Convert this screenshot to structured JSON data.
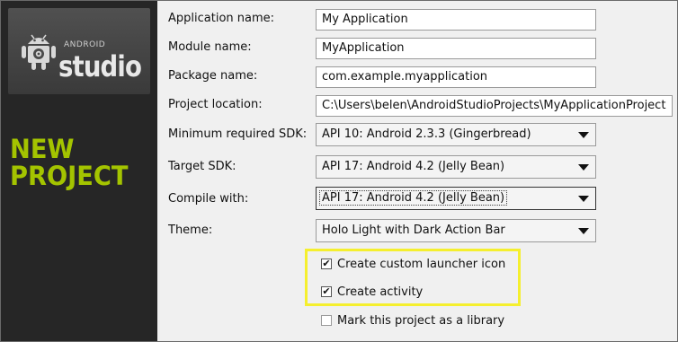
{
  "sidebar": {
    "logo_small_text": "ANDROID",
    "logo_text": "studio",
    "title_line1": "NEW",
    "title_line2": "PROJECT"
  },
  "form": {
    "app_name_label": "Application name:",
    "app_name_value": "My Application",
    "module_name_label": "Module name:",
    "module_name_value": "MyApplication",
    "package_name_label": "Package name:",
    "package_name_value": "com.example.myapplication",
    "project_location_label": "Project location:",
    "project_location_value": "C:\\Users\\belen\\AndroidStudioProjects\\MyApplicationProject",
    "min_sdk_label": "Minimum required SDK:",
    "min_sdk_value": "API 10: Android 2.3.3 (Gingerbread)",
    "target_sdk_label": "Target SDK:",
    "target_sdk_value": "API 17: Android 4.2 (Jelly Bean)",
    "compile_with_label": "Compile with:",
    "compile_with_value": "API 17: Android 4.2 (Jelly Bean)",
    "theme_label": "Theme:",
    "theme_value": "Holo Light with Dark Action Bar"
  },
  "options": {
    "create_icon_label": "Create custom launcher icon",
    "create_icon_checked": true,
    "create_activity_label": "Create activity",
    "create_activity_checked": true,
    "library_label": "Mark this project as a library",
    "library_checked": false
  },
  "colors": {
    "sidebar_bg": "#262626",
    "title_accent": "#a4c400",
    "highlight": "#f5ef2e"
  }
}
